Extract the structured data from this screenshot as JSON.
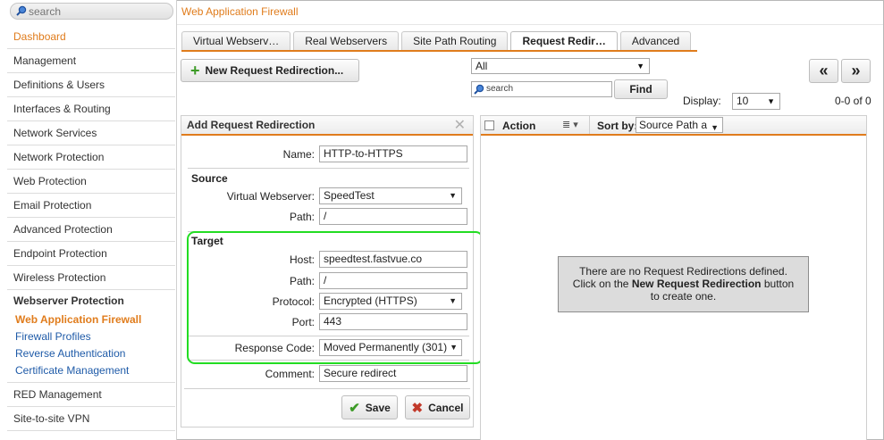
{
  "sidebar": {
    "search_placeholder": "search",
    "items": [
      {
        "label": "Dashboard"
      },
      {
        "label": "Management"
      },
      {
        "label": "Definitions & Users"
      },
      {
        "label": "Interfaces & Routing"
      },
      {
        "label": "Network Services"
      },
      {
        "label": "Network Protection"
      },
      {
        "label": "Web Protection"
      },
      {
        "label": "Email Protection"
      },
      {
        "label": "Advanced Protection"
      },
      {
        "label": "Endpoint Protection"
      },
      {
        "label": "Wireless Protection"
      }
    ],
    "group": {
      "label": "Webserver Protection",
      "subitems": [
        {
          "label": "Web Application Firewall"
        },
        {
          "label": "Firewall Profiles"
        },
        {
          "label": "Reverse Authentication"
        },
        {
          "label": "Certificate Management"
        }
      ]
    },
    "after_items": [
      {
        "label": "RED Management"
      },
      {
        "label": "Site-to-site VPN"
      }
    ]
  },
  "page": {
    "title": "Web Application Firewall",
    "tabs": [
      {
        "label": "Virtual Webserv…"
      },
      {
        "label": "Real Webservers"
      },
      {
        "label": "Site Path Routing"
      },
      {
        "label": "Request Redir…"
      },
      {
        "label": "Advanced"
      }
    ]
  },
  "toolbar": {
    "new_label": "New Request Redirection...",
    "filter_value": "All",
    "search_placeholder": "search",
    "find_label": "Find",
    "display_label": "Display:",
    "display_value": "10",
    "page_count": "0-0 of 0",
    "prev_label": "«",
    "next_label": "»"
  },
  "form": {
    "title": "Add Request Redirection",
    "name_label": "Name:",
    "name_value": "HTTP-to-HTTPS",
    "source_heading": "Source",
    "vws_label": "Virtual Webserver:",
    "vws_value": "SpeedTest",
    "src_path_label": "Path:",
    "src_path_value": "/",
    "target_heading": "Target",
    "host_label": "Host:",
    "host_value": "speedtest.fastvue.co",
    "tgt_path_label": "Path:",
    "tgt_path_value": "/",
    "protocol_label": "Protocol:",
    "protocol_value": "Encrypted (HTTPS)",
    "port_label": "Port:",
    "port_value": "443",
    "response_label": "Response Code:",
    "response_value": "Moved Permanently (301)",
    "comment_label": "Comment:",
    "comment_value": "Secure redirect",
    "save_label": "Save",
    "cancel_label": "Cancel"
  },
  "list": {
    "action_label": "Action",
    "sortby_label": "Sort by:",
    "sort_value": "Source Path a",
    "empty_line1": "There are no Request Redirections defined.",
    "empty_line2_pre": "Click on the ",
    "empty_line2_bold": "New Request Redirection",
    "empty_line2_post": " button",
    "empty_line3": "to create one."
  },
  "colors": {
    "accent": "#e07c1c",
    "link": "#1f5ba8",
    "highlight": "#22dd22",
    "add_green": "#3d9b27",
    "cancel_red": "#c23a2b"
  }
}
